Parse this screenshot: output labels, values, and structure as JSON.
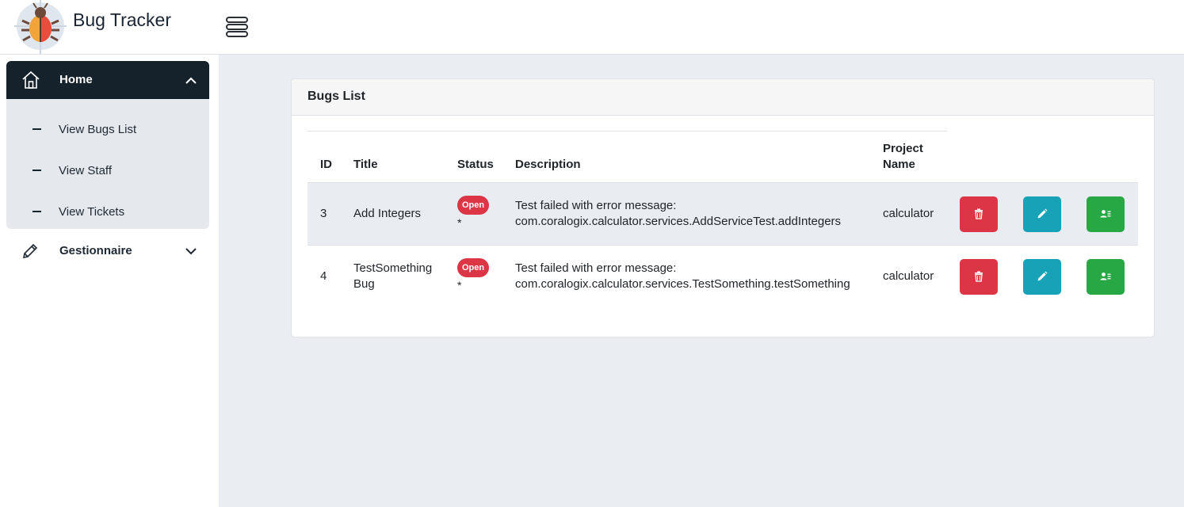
{
  "header": {
    "brand": "Bug Tracker"
  },
  "sidebar": {
    "home_label": "Home",
    "items": [
      {
        "label": "View Bugs List"
      },
      {
        "label": "View Staff"
      },
      {
        "label": "View Tickets"
      }
    ],
    "gestionnaire_label": "Gestionnaire"
  },
  "bugs": {
    "title": "Bugs List",
    "columns": {
      "id": "ID",
      "title": "Title",
      "status": "Status",
      "description": "Description",
      "project_line1": "Project",
      "project_line2": "Name"
    },
    "rows": [
      {
        "id": "3",
        "title_line1": "Add Integers",
        "title_line2": "",
        "status": "Open",
        "marker": "*",
        "desc_line1": "Test failed with error message:",
        "desc_line2": "com.coralogix.calculator.services.AddServiceTest.addIntegers",
        "project": "calculator"
      },
      {
        "id": "4",
        "title_line1": "TestSomething",
        "title_line2": "Bug",
        "status": "Open",
        "marker": "*",
        "desc_line1": "Test failed with error message:",
        "desc_line2": "com.coralogix.calculator.services.TestSomething.testSomething",
        "project": "calculator"
      }
    ]
  },
  "colors": {
    "danger": "#dc3545",
    "info": "#17a2b8",
    "success": "#28a745",
    "sidebar_active": "#16222b"
  },
  "icons": {
    "logo": "bug-logo-icon",
    "menu": "hamburger-menu-icon",
    "home": "home-icon",
    "edit_nav": "pencil-icon",
    "delete": "trash-icon",
    "edit": "pencil-icon",
    "assign": "user-assign-icon"
  }
}
